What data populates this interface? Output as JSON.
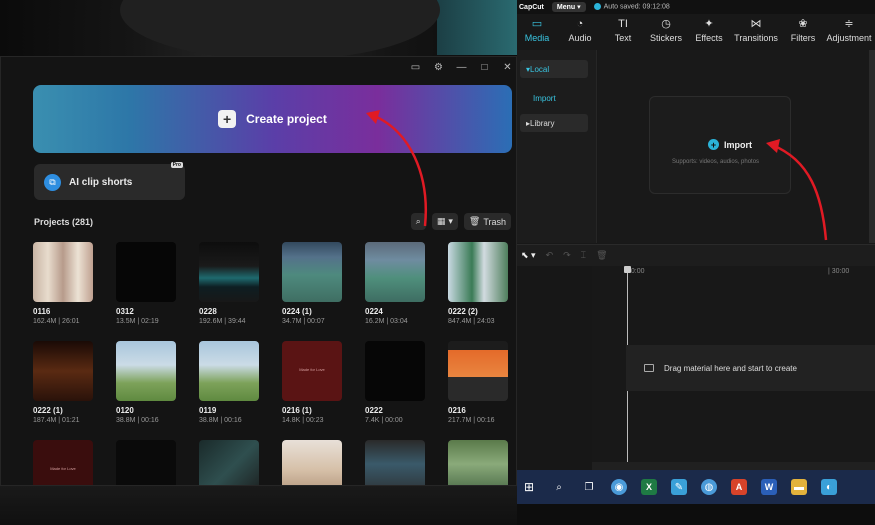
{
  "home": {
    "create_label": "Create project",
    "ai_clip_label": "AI clip shorts",
    "ai_clip_badge": "Pro",
    "projects_label": "Projects",
    "projects_count": "(281)",
    "trash_label": "Trash",
    "projects": [
      {
        "name": "0116",
        "meta": "162.4M | 26:01",
        "thumb": "t-pink"
      },
      {
        "name": "0312",
        "meta": "13.5M | 02:19",
        "thumb": "t-black"
      },
      {
        "name": "0228",
        "meta": "192.6M | 39:44",
        "thumb": "t-shirt"
      },
      {
        "name": "0224 (1)",
        "meta": "34.7M | 00:07",
        "thumb": "t-court"
      },
      {
        "name": "0224",
        "meta": "16.2M | 03:04",
        "thumb": "t-court2"
      },
      {
        "name": "0222 (2)",
        "meta": "847.4M | 24:03",
        "thumb": "t-outdoor"
      },
      {
        "name": "0222 (1)",
        "meta": "187.4M | 01:21",
        "thumb": "t-warm"
      },
      {
        "name": "0120",
        "meta": "38.8M | 00:16",
        "thumb": "t-field"
      },
      {
        "name": "0119",
        "meta": "38.8M | 00:16",
        "thumb": "t-field"
      },
      {
        "name": "0216 (1)",
        "meta": "14.8K | 00:23",
        "thumb": "t-red"
      },
      {
        "name": "0222",
        "meta": "7.4K | 00:00",
        "thumb": "t-black"
      },
      {
        "name": "0216",
        "meta": "217.7M | 00:16",
        "thumb": "t-screen"
      },
      {
        "name": "",
        "meta": "",
        "thumb": "t-dark1"
      },
      {
        "name": "",
        "meta": "",
        "thumb": "t-dark2"
      },
      {
        "name": "",
        "meta": "",
        "thumb": "t-edit"
      },
      {
        "name": "",
        "meta": "",
        "thumb": "t-girl"
      },
      {
        "name": "",
        "meta": "",
        "thumb": "t-ui"
      },
      {
        "name": "",
        "meta": "",
        "thumb": "t-man"
      }
    ],
    "thumb_caption": "Made for Love"
  },
  "editor": {
    "app_name": "CapCut",
    "menu_label": "Menu",
    "autosave": "Auto saved: 09:12:08",
    "tabs": [
      {
        "label": "Media",
        "icon": "▭"
      },
      {
        "label": "Audio",
        "icon": "◔"
      },
      {
        "label": "Text",
        "icon": "TI"
      },
      {
        "label": "Stickers",
        "icon": "◷"
      },
      {
        "label": "Effects",
        "icon": "✦"
      },
      {
        "label": "Transitions",
        "icon": "⋈"
      },
      {
        "label": "Filters",
        "icon": "❀"
      },
      {
        "label": "Adjustment",
        "icon": "≑"
      }
    ],
    "side": {
      "local": "Local",
      "import": "Import",
      "library": "Library"
    },
    "import_label": "Import",
    "import_sub": "Supports: videos, audios, photos",
    "timeline": {
      "time_start": "00:00",
      "time_mark": "| 30:00",
      "drop_text": "Drag material here and start to create"
    }
  },
  "colors": {
    "accent": "#2bb3d8",
    "arrow": "#e01a24"
  }
}
